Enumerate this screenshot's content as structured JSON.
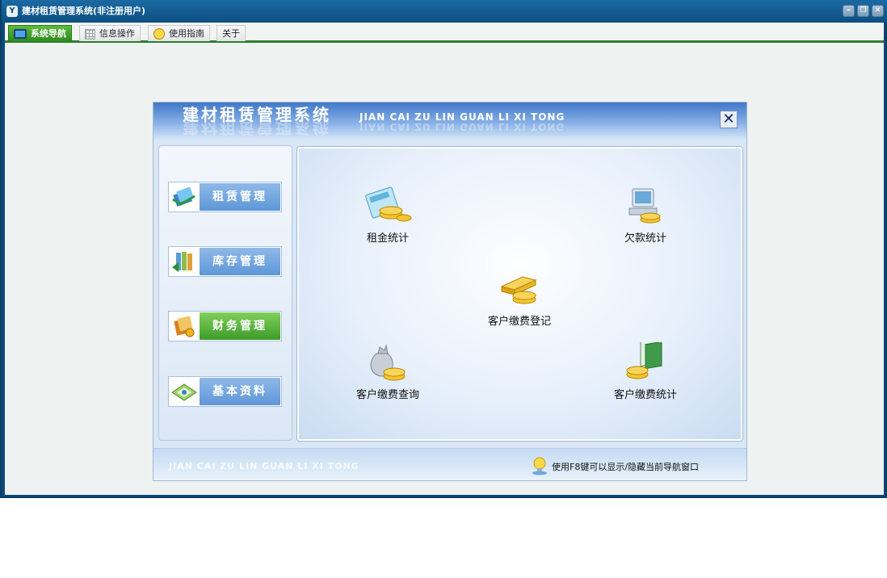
{
  "window": {
    "title": "建材租赁管理系统(非注册用户)",
    "logo_text": "Y",
    "controls": {
      "minimize": "–",
      "restore": "❐",
      "close": "✕"
    }
  },
  "menu": {
    "tabs": [
      {
        "label": "系统导航",
        "icon": "monitor-icon",
        "active": true
      },
      {
        "label": "信息操作",
        "icon": "grid-icon",
        "active": false
      },
      {
        "label": "使用指南",
        "icon": "smiley-icon",
        "active": false
      },
      {
        "label": "关于",
        "icon": "",
        "active": false
      }
    ]
  },
  "nav_panel": {
    "title_cn": "建材租赁管理系统",
    "title_en": "JIAN CAI ZU LIN GUAN LI XI TONG",
    "close_symbol": "✕",
    "side_buttons": [
      {
        "label": "租赁管理",
        "icon": "lease-icon",
        "active": false
      },
      {
        "label": "库存管理",
        "icon": "inventory-icon",
        "active": false
      },
      {
        "label": "财务管理",
        "icon": "finance-icon",
        "active": true
      },
      {
        "label": "基本资料",
        "icon": "basic-info-icon",
        "active": false
      }
    ],
    "features": [
      {
        "label": "租金统计",
        "icon": "calculator-coins-icon"
      },
      {
        "label": "欠款统计",
        "icon": "computer-coins-icon"
      },
      {
        "label": "客户缴费登记",
        "icon": "gold-bars-icon"
      },
      {
        "label": "客户缴费查询",
        "icon": "money-bag-icon"
      },
      {
        "label": "客户缴费统计",
        "icon": "banknotes-coins-icon"
      }
    ],
    "footer_en": "JIAN CAI ZU LIN GUAN LI XI TONG",
    "footer_tip": "使用F8键可以显示/隐藏当前导航窗口"
  }
}
